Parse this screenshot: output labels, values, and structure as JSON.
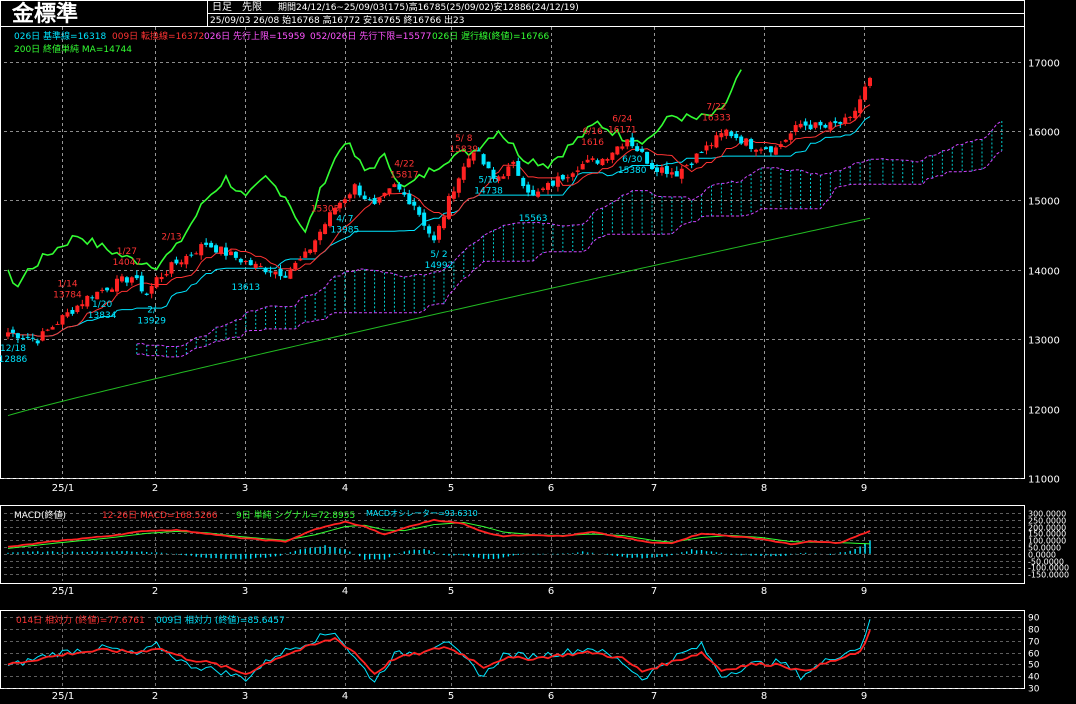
{
  "header": {
    "title": "金標準",
    "line1_a": "日足",
    "line1_b": "先限",
    "line1_c": "期間24/12/16~25/09/03(175)高16785(25/09/02)安12886(24/12/19)",
    "line2": "25/09/03 26/08 始16768 高16772 安16765 終16766 出23"
  },
  "legend": {
    "row1": [
      {
        "text": "026日 基準線=16318",
        "color": "#00e5ff"
      },
      {
        "text": "009日 転換線=16372",
        "color": "#ff3333"
      },
      {
        "text": "026日 先行上限=15959",
        "color": "#ff55ff"
      },
      {
        "text": "052/026日 先行下限=15577",
        "color": "#ff55ff"
      },
      {
        "text": "026日 遅行線(終値)=16766",
        "color": "#33ff33"
      }
    ],
    "row2": [
      {
        "text": "200日 終値単純 MA=14744",
        "color": "#33ff33"
      }
    ]
  },
  "macd_legend": {
    "label": "MACD(終値)",
    "macd": "12-26日 MACD=168.5266",
    "signal": "9日 単純 シグナル=72.8955",
    "osc": "MACDオシレーター=93.6310"
  },
  "rsi_legend": {
    "a": "014日 相対力 (終値)=77.6761",
    "b": "009日 相対力 (終値)=85.6457"
  },
  "colors": {
    "up": "#ff2222",
    "down": "#00e5ff",
    "kijun": "#00e5ff",
    "tenkan": "#ff3333",
    "span": "#cc44ff",
    "chikou": "#33ff33",
    "ma200": "#22bb22",
    "grid": "#bbbbbb",
    "frame": "#ffffff"
  },
  "chart_data": [
    {
      "type": "candlestick",
      "title": "金標準",
      "ylim": [
        11000,
        17500
      ],
      "y_ticks": [
        11000,
        12000,
        13000,
        14000,
        15000,
        16000,
        17000
      ],
      "x_ticks": [
        "25/1",
        "2",
        "3",
        "4",
        "5",
        "6",
        "7",
        "8",
        "9"
      ],
      "grid": true,
      "close_path": [
        [
          0,
          13100
        ],
        [
          6,
          13000
        ],
        [
          10,
          13250
        ],
        [
          16,
          13600
        ],
        [
          20,
          13750
        ],
        [
          25,
          13900
        ],
        [
          28,
          13650
        ],
        [
          30,
          13870
        ],
        [
          34,
          14100
        ],
        [
          40,
          14380
        ],
        [
          44,
          14240
        ],
        [
          50,
          14050
        ],
        [
          56,
          13950
        ],
        [
          60,
          14200
        ],
        [
          66,
          14900
        ],
        [
          70,
          15200
        ],
        [
          74,
          14900
        ],
        [
          78,
          15200
        ],
        [
          82,
          14950
        ],
        [
          86,
          14400
        ],
        [
          90,
          15200
        ],
        [
          94,
          15750
        ],
        [
          98,
          15300
        ],
        [
          102,
          15500
        ],
        [
          106,
          15050
        ],
        [
          110,
          15250
        ],
        [
          115,
          15500
        ],
        [
          120,
          15600
        ],
        [
          125,
          15900
        ],
        [
          130,
          15500
        ],
        [
          135,
          15400
        ],
        [
          140,
          15700
        ],
        [
          145,
          16000
        ],
        [
          150,
          15800
        ],
        [
          155,
          15750
        ],
        [
          160,
          16100
        ],
        [
          165,
          16050
        ],
        [
          170,
          16150
        ],
        [
          174,
          16766
        ]
      ],
      "annotations": [
        {
          "x": 1,
          "text": "12/18",
          "sub": "12886",
          "color": "#00e5ff"
        },
        {
          "x": 12,
          "text": "1/14",
          "sub": "13784",
          "color": "#ff3333"
        },
        {
          "x": 19,
          "text": "1/20",
          "sub": "13834",
          "color": "#00e5ff"
        },
        {
          "x": 24,
          "text": "1/27",
          "sub": "14047",
          "color": "#ff3333"
        },
        {
          "x": 29,
          "text": "2/",
          "sub": "13929",
          "color": "#00e5ff"
        },
        {
          "x": 33,
          "text": "2/13",
          "sub": "",
          "color": "#ff3333"
        },
        {
          "x": 48,
          "text": "",
          "sub": "13613",
          "color": "#00e5ff"
        },
        {
          "x": 64,
          "text": "",
          "sub": "15303",
          "color": "#ff3333"
        },
        {
          "x": 68,
          "text": "4/ 7",
          "sub": "13985",
          "color": "#00e5ff"
        },
        {
          "x": 80,
          "text": "4/22",
          "sub": "15817",
          "color": "#ff3333"
        },
        {
          "x": 87,
          "text": "5/ 2",
          "sub": "14992",
          "color": "#00e5ff"
        },
        {
          "x": 92,
          "text": "5/ 8",
          "sub": "15839",
          "color": "#ff3333"
        },
        {
          "x": 97,
          "text": "5/15",
          "sub": "14738",
          "color": "#00e5ff"
        },
        {
          "x": 106,
          "text": "",
          "sub": "15563",
          "color": "#00e5ff"
        },
        {
          "x": 118,
          "text": "6/16",
          "sub": "1616",
          "color": "#ff3333"
        },
        {
          "x": 124,
          "text": "6/24",
          "sub": "16171",
          "color": "#ff3333"
        },
        {
          "x": 126,
          "text": "6/30",
          "sub": "15380",
          "color": "#00e5ff"
        },
        {
          "x": 143,
          "text": "7/22",
          "sub": "16333",
          "color": "#ff3333"
        }
      ]
    },
    {
      "type": "line",
      "title": "MACD(終値)",
      "ylim": [
        -200,
        300
      ],
      "y_ticks": [
        -150,
        -100,
        -50,
        0,
        50,
        100,
        150,
        200,
        250,
        300
      ],
      "y_tick_labels": [
        "-150.0000",
        "-100.0000",
        "-50.0000",
        "0.0000",
        "50.0000",
        "100.0000",
        "150.0000",
        "200.0000",
        "250.0000",
        "300.0000"
      ],
      "series": [
        {
          "name": "MACD",
          "points": [
            [
              0,
              50
            ],
            [
              10,
              95
            ],
            [
              20,
              130
            ],
            [
              28,
              170
            ],
            [
              34,
              175
            ],
            [
              40,
              150
            ],
            [
              46,
              120
            ],
            [
              52,
              100
            ],
            [
              56,
              90
            ],
            [
              62,
              180
            ],
            [
              68,
              235
            ],
            [
              72,
              200
            ],
            [
              76,
              140
            ],
            [
              80,
              190
            ],
            [
              86,
              250
            ],
            [
              92,
              220
            ],
            [
              96,
              160
            ],
            [
              100,
              130
            ],
            [
              106,
              140
            ],
            [
              112,
              130
            ],
            [
              118,
              160
            ],
            [
              124,
              120
            ],
            [
              130,
              80
            ],
            [
              134,
              80
            ],
            [
              140,
              150
            ],
            [
              146,
              130
            ],
            [
              152,
              110
            ],
            [
              158,
              70
            ],
            [
              162,
              90
            ],
            [
              168,
              80
            ],
            [
              174,
              168
            ]
          ]
        },
        {
          "name": "シグナル",
          "points": [
            [
              0,
              40
            ],
            [
              10,
              80
            ],
            [
              20,
              115
            ],
            [
              28,
              150
            ],
            [
              34,
              165
            ],
            [
              40,
              155
            ],
            [
              46,
              130
            ],
            [
              52,
              110
            ],
            [
              56,
              100
            ],
            [
              62,
              140
            ],
            [
              68,
              200
            ],
            [
              72,
              210
            ],
            [
              76,
              175
            ],
            [
              80,
              170
            ],
            [
              86,
              215
            ],
            [
              92,
              230
            ],
            [
              96,
              200
            ],
            [
              100,
              160
            ],
            [
              106,
              140
            ],
            [
              112,
              135
            ],
            [
              118,
              145
            ],
            [
              124,
              135
            ],
            [
              130,
              100
            ],
            [
              134,
              85
            ],
            [
              140,
              120
            ],
            [
              146,
              135
            ],
            [
              152,
              120
            ],
            [
              158,
              90
            ],
            [
              162,
              85
            ],
            [
              168,
              82
            ],
            [
              174,
              73
            ]
          ]
        }
      ],
      "histogram": [
        [
          0,
          10
        ],
        [
          6,
          15
        ],
        [
          12,
          15
        ],
        [
          18,
          15
        ],
        [
          24,
          20
        ],
        [
          30,
          10
        ],
        [
          36,
          -10
        ],
        [
          42,
          -35
        ],
        [
          48,
          -40
        ],
        [
          54,
          -20
        ],
        [
          60,
          40
        ],
        [
          64,
          60
        ],
        [
          68,
          35
        ],
        [
          72,
          -40
        ],
        [
          76,
          -40
        ],
        [
          80,
          20
        ],
        [
          84,
          35
        ],
        [
          88,
          -10
        ],
        [
          92,
          -10
        ],
        [
          96,
          -40
        ],
        [
          100,
          -30
        ],
        [
          104,
          0
        ],
        [
          110,
          -5
        ],
        [
          116,
          15
        ],
        [
          122,
          -15
        ],
        [
          126,
          -30
        ],
        [
          130,
          -30
        ],
        [
          134,
          -10
        ],
        [
          138,
          30
        ],
        [
          142,
          20
        ],
        [
          146,
          -5
        ],
        [
          150,
          -10
        ],
        [
          156,
          -20
        ],
        [
          160,
          5
        ],
        [
          166,
          -5
        ],
        [
          170,
          20
        ],
        [
          174,
          94
        ]
      ],
      "legend": [
        "12-26日 MACD=168.5266",
        "9日 単純 シグナル=72.8955",
        "MACDオシレーター=93.6310"
      ]
    },
    {
      "type": "line",
      "title": "相対力",
      "ylim": [
        30,
        90
      ],
      "y_ticks": [
        30,
        40,
        50,
        60,
        70,
        80,
        90
      ],
      "series": [
        {
          "name": "014日 相対力 (終値)",
          "points": [
            [
              0,
              50
            ],
            [
              8,
              56
            ],
            [
              14,
              60
            ],
            [
              20,
              62
            ],
            [
              26,
              60
            ],
            [
              30,
              64
            ],
            [
              36,
              55
            ],
            [
              42,
              50
            ],
            [
              48,
              42
            ],
            [
              54,
              55
            ],
            [
              60,
              64
            ],
            [
              66,
              72
            ],
            [
              70,
              60
            ],
            [
              74,
              42
            ],
            [
              78,
              55
            ],
            [
              84,
              60
            ],
            [
              88,
              65
            ],
            [
              92,
              58
            ],
            [
              96,
              48
            ],
            [
              100,
              55
            ],
            [
              106,
              55
            ],
            [
              112,
              58
            ],
            [
              118,
              60
            ],
            [
              124,
              55
            ],
            [
              128,
              44
            ],
            [
              134,
              52
            ],
            [
              140,
              60
            ],
            [
              144,
              45
            ],
            [
              150,
              50
            ],
            [
              156,
              50
            ],
            [
              160,
              44
            ],
            [
              166,
              52
            ],
            [
              172,
              60
            ],
            [
              174,
              77.7
            ]
          ]
        },
        {
          "name": "009日 相対力 (終値)",
          "points": [
            [
              0,
              48
            ],
            [
              8,
              58
            ],
            [
              14,
              62
            ],
            [
              20,
              64
            ],
            [
              26,
              58
            ],
            [
              30,
              66
            ],
            [
              36,
              50
            ],
            [
              42,
              45
            ],
            [
              48,
              38
            ],
            [
              54,
              58
            ],
            [
              60,
              68
            ],
            [
              66,
              78
            ],
            [
              70,
              55
            ],
            [
              74,
              36
            ],
            [
              78,
              58
            ],
            [
              84,
              62
            ],
            [
              88,
              70
            ],
            [
              92,
              55
            ],
            [
              96,
              40
            ],
            [
              100,
              58
            ],
            [
              106,
              57
            ],
            [
              112,
              60
            ],
            [
              118,
              64
            ],
            [
              124,
              52
            ],
            [
              128,
              38
            ],
            [
              134,
              55
            ],
            [
              140,
              66
            ],
            [
              144,
              40
            ],
            [
              150,
              50
            ],
            [
              156,
              52
            ],
            [
              160,
              40
            ],
            [
              166,
              55
            ],
            [
              172,
              65
            ],
            [
              174,
              85.6
            ]
          ]
        }
      ],
      "legend": [
        "014日 相対力 (終値)=77.6761",
        "009日 相対力 (終値)=85.6457"
      ]
    }
  ]
}
